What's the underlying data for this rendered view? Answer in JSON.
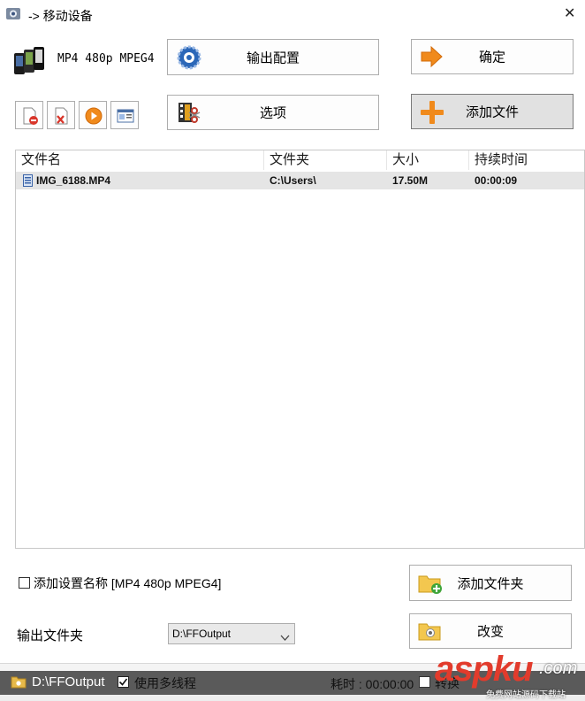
{
  "window": {
    "title": "-> 移动设备",
    "close_glyph": "✕"
  },
  "profile": {
    "label": "MP4 480p MPEG4"
  },
  "buttons": {
    "output_config": "输出配置",
    "ok": "确定",
    "options": "选项",
    "add_file": "添加文件",
    "add_folder": "添加文件夹",
    "change": "改变"
  },
  "table": {
    "headers": [
      "文件名",
      "文件夹",
      "大小",
      "持续时间"
    ],
    "rows": [
      {
        "name": "IMG_6188.MP4",
        "folder": "C:\\Users\\",
        "size": "17.50M",
        "duration": "00:00:09"
      }
    ]
  },
  "settings": {
    "add_name_label": "添加设置名称 [MP4 480p MPEG4]",
    "add_name_checked": false,
    "output_folder_label": "输出文件夹",
    "output_folder_value": "D:\\FFOutput"
  },
  "status": {
    "path": "D:\\FFOutput",
    "multithread_label": "使用多线程",
    "multithread_checked": true,
    "elapsed": "耗时 : 00:00:00",
    "convert_label": "转换"
  },
  "watermark": {
    "brand": "aspku",
    "suffix": ".com",
    "sub": "免费网站源码下载站"
  },
  "colors": {
    "accent_orange": "#f08a1c",
    "selected_row": "#e5e5e5",
    "statusbar": "#5a5a5a"
  }
}
